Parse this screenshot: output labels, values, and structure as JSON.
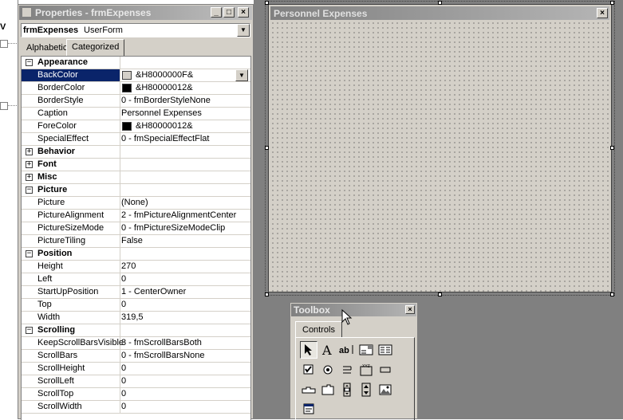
{
  "properties": {
    "title": "Properties - frmExpenses",
    "object_name": "frmExpenses",
    "object_type": "UserForm",
    "tabs": [
      "Alphabetic",
      "Categorized"
    ],
    "rows": [
      {
        "kind": "category",
        "expander": "−",
        "name": "Appearance"
      },
      {
        "kind": "prop",
        "name": "BackColor",
        "value": "&H8000000F&",
        "swatch": "#d4d0c8",
        "selected": true
      },
      {
        "kind": "prop",
        "name": "BorderColor",
        "value": "&H80000012&",
        "swatch": "#000000"
      },
      {
        "kind": "prop",
        "name": "BorderStyle",
        "value": "0 - fmBorderStyleNone"
      },
      {
        "kind": "prop",
        "name": "Caption",
        "value": "Personnel Expenses"
      },
      {
        "kind": "prop",
        "name": "ForeColor",
        "value": "&H80000012&",
        "swatch": "#000000"
      },
      {
        "kind": "prop",
        "name": "SpecialEffect",
        "value": "0 - fmSpecialEffectFlat"
      },
      {
        "kind": "category",
        "expander": "+",
        "name": "Behavior"
      },
      {
        "kind": "category",
        "expander": "+",
        "name": "Font"
      },
      {
        "kind": "category",
        "expander": "+",
        "name": "Misc"
      },
      {
        "kind": "category",
        "expander": "−",
        "name": "Picture"
      },
      {
        "kind": "prop",
        "name": "Picture",
        "value": "(None)"
      },
      {
        "kind": "prop",
        "name": "PictureAlignment",
        "value": "2 - fmPictureAlignmentCenter"
      },
      {
        "kind": "prop",
        "name": "PictureSizeMode",
        "value": "0 - fmPictureSizeModeClip"
      },
      {
        "kind": "prop",
        "name": "PictureTiling",
        "value": "False"
      },
      {
        "kind": "category",
        "expander": "−",
        "name": "Position"
      },
      {
        "kind": "prop",
        "name": "Height",
        "value": "270"
      },
      {
        "kind": "prop",
        "name": "Left",
        "value": "0"
      },
      {
        "kind": "prop",
        "name": "StartUpPosition",
        "value": "1 - CenterOwner"
      },
      {
        "kind": "prop",
        "name": "Top",
        "value": "0"
      },
      {
        "kind": "prop",
        "name": "Width",
        "value": "319,5"
      },
      {
        "kind": "category",
        "expander": "−",
        "name": "Scrolling"
      },
      {
        "kind": "prop",
        "name": "KeepScrollBarsVisible",
        "value": "3 - fmScrollBarsBoth"
      },
      {
        "kind": "prop",
        "name": "ScrollBars",
        "value": "0 - fmScrollBarsNone"
      },
      {
        "kind": "prop",
        "name": "ScrollHeight",
        "value": "0"
      },
      {
        "kind": "prop",
        "name": "ScrollLeft",
        "value": "0"
      },
      {
        "kind": "prop",
        "name": "ScrollTop",
        "value": "0"
      },
      {
        "kind": "prop",
        "name": "ScrollWidth",
        "value": "0"
      }
    ]
  },
  "explorer": {
    "label": "V"
  },
  "form": {
    "caption": "Personnel Expenses"
  },
  "toolbox": {
    "title": "Toolbox",
    "tab": "Controls",
    "tools": [
      "select-objects",
      "label",
      "textbox",
      "combobox",
      "listbox",
      "checkbox",
      "optionbutton",
      "togglebutton",
      "frame",
      "commandbutton",
      "tabstrip",
      "multipage",
      "scrollbar",
      "spinbutton",
      "image",
      "refedit"
    ]
  },
  "colors": {
    "selection": "#0a246a",
    "face": "#d4d0c8",
    "title_inactive": "#808080"
  }
}
